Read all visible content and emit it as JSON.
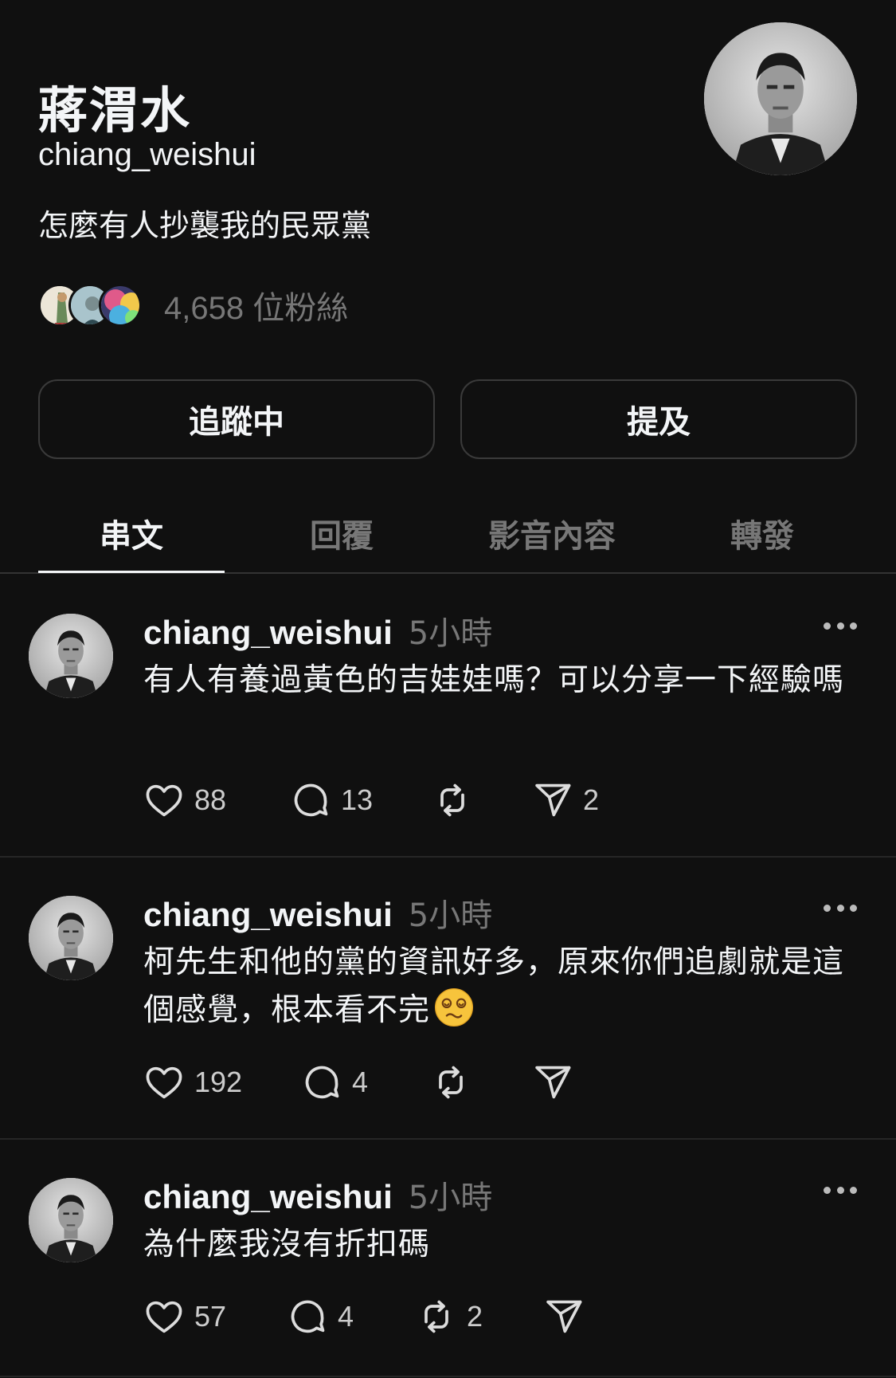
{
  "profile": {
    "display_name": "蔣渭水",
    "username": "chiang_weishui",
    "bio": "怎麼有人抄襲我的民眾黨",
    "followers": "4,658 位粉絲",
    "follow_button": "追蹤中",
    "mention_button": "提及"
  },
  "tabs": [
    "串文",
    "回覆",
    "影音內容",
    "轉發"
  ],
  "posts": [
    {
      "user": "chiang_weishui",
      "time": "5小時",
      "text": "有人有養過黃色的吉娃娃嗎？可以分享一下經驗嗎",
      "likes": "88",
      "replies": "13",
      "reposts": "",
      "shares": "2"
    },
    {
      "user": "chiang_weishui",
      "time": "5小時",
      "text": "柯先生和他的黨的資訊好多，原來你們追劇就是這個感覺，根本看不完",
      "emoji": "dizzy-face",
      "likes": "192",
      "replies": "4",
      "reposts": "",
      "shares": ""
    },
    {
      "user": "chiang_weishui",
      "time": "5小時",
      "text": "為什麼我沒有折扣碼",
      "likes": "57",
      "replies": "4",
      "reposts": "2",
      "shares": ""
    }
  ],
  "icons": {
    "like": "heart-icon",
    "reply": "comment-icon",
    "repost": "repost-icon",
    "share": "send-icon",
    "more": "more-icon"
  },
  "colors": {
    "background": "#101010",
    "text": "#f3f5f7",
    "muted": "#777777"
  }
}
